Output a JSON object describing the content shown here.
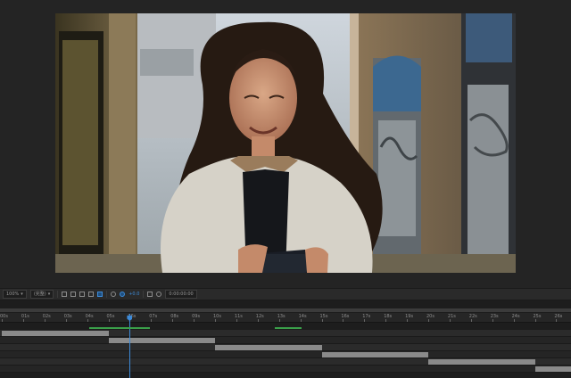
{
  "toolbar": {
    "zoom": "100%",
    "resolution": "(完整)",
    "timecode": "0:00:00:00",
    "offset": "+0.0"
  },
  "ruler": {
    "ticks": [
      "00s",
      "01s",
      "02s",
      "03s",
      "04s",
      "05s",
      "06s",
      "07s",
      "08s",
      "09s",
      "10s",
      "11s",
      "12s",
      "13s",
      "14s",
      "15s",
      "16s",
      "17s",
      "18s",
      "19s",
      "20s",
      "21s",
      "22s",
      "23s",
      "24s",
      "25s",
      "26s"
    ]
  },
  "colors": {
    "accent": "#3d8bd9",
    "clip": "#8a8a8a",
    "keyframes": "#3aa04a"
  },
  "icons": {
    "grid": "grid-icon",
    "mask": "mask-icon",
    "region": "region-of-interest-icon",
    "transparency": "transparency-grid-icon",
    "snapshot": "camera-icon",
    "color": "color-channel-icon",
    "exposure": "exposure-icon"
  },
  "tracks": [
    {
      "start_s": 0.0,
      "end_s": 5.0
    },
    {
      "start_s": 5.0,
      "end_s": 10.0
    },
    {
      "start_s": 10.0,
      "end_s": 15.0
    },
    {
      "start_s": 15.0,
      "end_s": 20.0
    },
    {
      "start_s": 20.0,
      "end_s": 25.0
    },
    {
      "start_s": 25.0,
      "end_s": 26.7
    }
  ],
  "playhead_s": 6.0
}
